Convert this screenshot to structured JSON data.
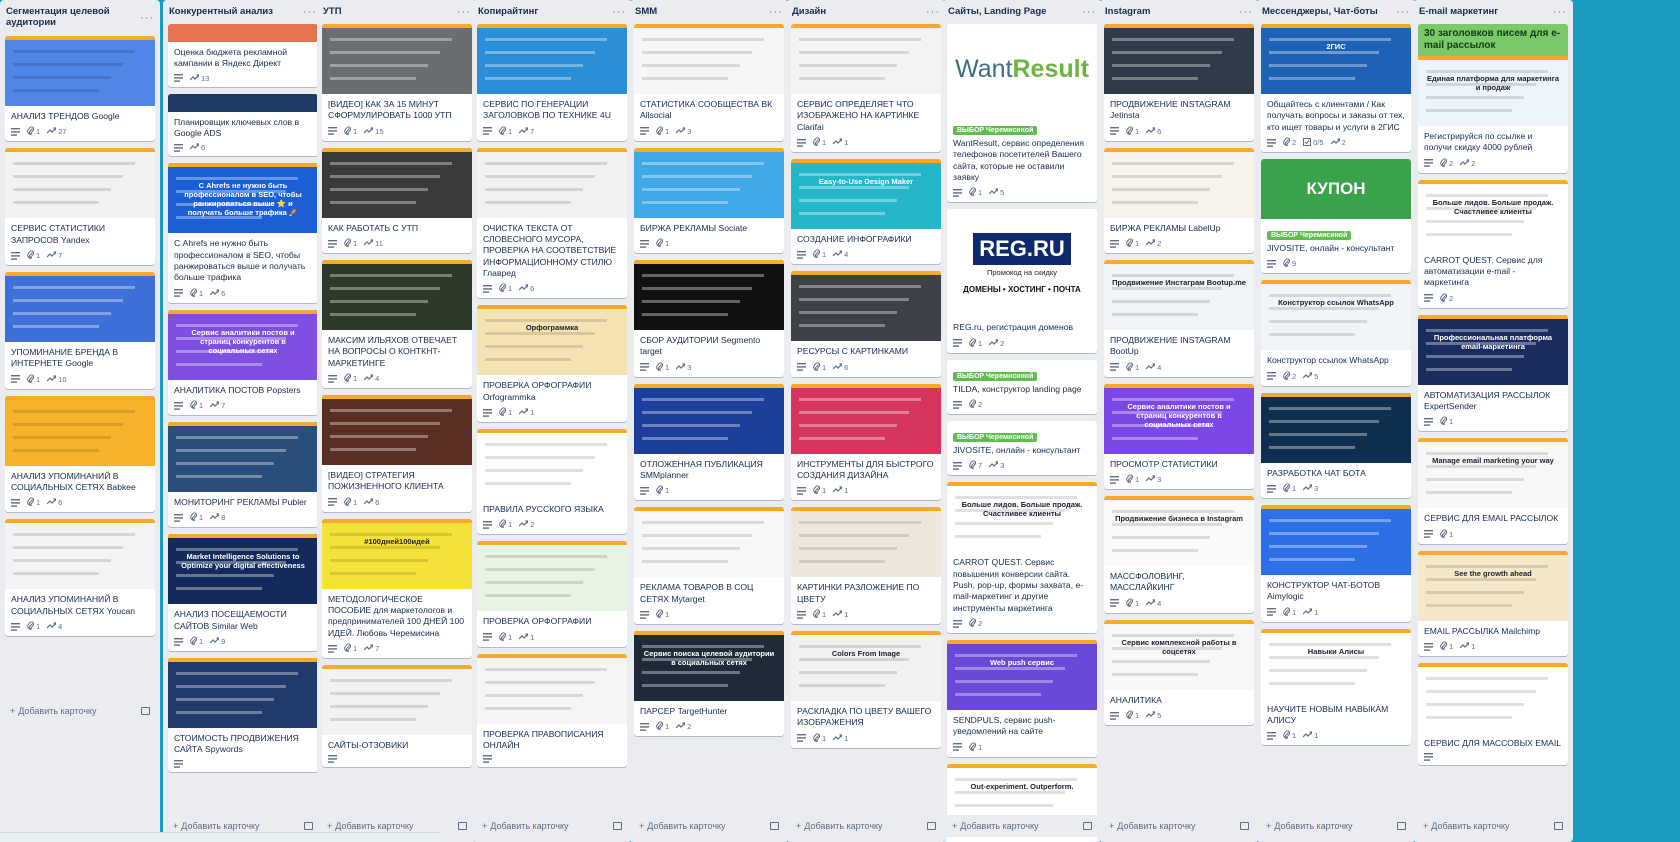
{
  "add_card_label": "Добавить карточку",
  "menu_glyph": "···",
  "icons": {
    "description": "description-icon",
    "attachment": "attachment-icon",
    "activity": "trend-icon",
    "checklist": "checklist-icon"
  },
  "colors": {
    "board": "#1a9bc2",
    "list": "#ebecf0",
    "cover_bar": "#f7a928",
    "label_green": "#61bd4f"
  },
  "columns": [
    {
      "title": "Сегментация целевой аудитории",
      "cards": [
        {
          "title": "АНАЛИЗ ТРЕНДОВ Google",
          "cover": "#4f86e8",
          "badges": [
            "1",
            "27"
          ]
        },
        {
          "title": "СЕРВИС СТАТИСТИКИ ЗАПРОСОВ Yandex",
          "cover": "#f2f2f2",
          "badges": [
            "1",
            "7"
          ]
        },
        {
          "title": "УПОМИНАНИЕ БРЕНДА В ИНТЕРНЕТЕ Google",
          "cover": "#3f6fd8",
          "badges": [
            "1",
            "10"
          ]
        },
        {
          "title": "АНАЛИЗ УПОМИНАНИЙ В СОЦИАЛЬНЫХ СЕТЯХ Babkee",
          "cover": "#f6b22a",
          "badges": [
            "1",
            "6"
          ]
        },
        {
          "title": "АНАЛИЗ УПОМИНАНИЙ В СОЦИАЛЬНЫХ СЕТЯХ Youcan",
          "cover": "#f3f3f6",
          "badges": [
            "1",
            "4"
          ]
        }
      ]
    },
    {
      "title": "Конкурентный анализ",
      "cards": [
        {
          "title": "Оценка бюджета рекламной кампании в Яндекс Директ",
          "cover": "#e57352",
          "cover_short": true,
          "badges": [
            "13"
          ]
        },
        {
          "title": "Планировщик ключевых слов в Google ADS",
          "cover": "#1c3a63",
          "cover_short": true,
          "badges": [
            "6"
          ]
        },
        {
          "title": "С Ahrefs не нужно быть профессионалом в SEO, чтобы ранжироваться выше и получать больше трафика",
          "cover": "#1a5fd6",
          "cover_text": "С Ahrefs не нужно быть профессионалом в SEO, чтобы ранжироваться выше ⭐ и получать больше трафика 🚀",
          "badges": [
            "1",
            "6"
          ]
        },
        {
          "title": "АНАЛИТИКА ПОСТОВ Popsters",
          "cover": "#7e4fe0",
          "cover_text": "Сервис аналитики постов и страниц конкурентов в социальных сетях",
          "badges": [
            "1",
            "7"
          ]
        },
        {
          "title": "МОНИТОРИНГ РЕКЛАМЫ Publer",
          "cover": "#2a4f7a",
          "badges": [
            "1",
            "8"
          ]
        },
        {
          "title": "АНАЛИЗ ПОСЕЩАЕМОСТИ САЙТОВ Similar Web",
          "cover": "#132a5a",
          "cover_text": "Market Intelligence Solutions to Optimize your digital effectiveness",
          "badges": [
            "1",
            "9"
          ]
        },
        {
          "title": "СТОИМОСТЬ ПРОДВИЖЕНИЯ САЙТА Spywords",
          "cover": "#1f3a6b",
          "badges": []
        }
      ]
    },
    {
      "title": "УТП",
      "cards": [
        {
          "title": "[ВИДЕО] КАК ЗА 15 МИНУТ СФОРМУЛИРОВАТЬ 1000 УТП",
          "cover": "#6b6e70",
          "badges": [
            "1",
            "15"
          ]
        },
        {
          "title": "КАК РАБОТАТЬ С УТП",
          "cover": "#3a3a3a",
          "badges": [
            "1",
            "11"
          ]
        },
        {
          "title": "МАКСИМ ИЛЬЯХОВ ОТВЕЧАЕТ НА ВОПРОСЫ О КОНТКНТ-МАРКЕТИНГЕ",
          "cover": "#2d3a2a",
          "badges": [
            "1",
            "4"
          ]
        },
        {
          "title": "[ВИДЕО] СТРАТЕГИЯ ПОЖИЗНЕННОГО КЛИЕНТА",
          "cover": "#5a2e22",
          "badges": [
            "1",
            "6"
          ]
        },
        {
          "title": "МЕТОДОЛОГИЧЕСКОЕ ПОСОБИЕ для маркетологов и предпринимателей 100 ДНЕЙ 100 ИДЕЙ. Любовь Черемисина",
          "cover": "#f4e23a",
          "cover_text": "#100дней100идей",
          "badges": [
            "1",
            "7"
          ]
        },
        {
          "title": "САЙТЫ-ОТЗОВИКИ",
          "cover": "#f2f2f2",
          "badges": []
        }
      ]
    },
    {
      "title": "Копирайтинг",
      "cards": [
        {
          "title": "СЕРВИС ПО ГЕНЕРАЦИИ ЗАГОЛОВКОВ ПО ТЕХНИКЕ 4U",
          "cover": "#2a8fd6",
          "badges": [
            "1",
            "7"
          ]
        },
        {
          "title": "ОЧИСТКА ТЕКСТА ОТ СЛОВЕСНОГО МУСОРА, ПРОВЕРКА НА СООТВЕТСТВИЕ ИНФОРМАЦИОННОМУ СТИЛЮ Главред",
          "cover": "#f1f1f1",
          "badges": [
            "1",
            "6"
          ]
        },
        {
          "title": "ПРОВЕРКА ОРФОГРАФИИ Orfogrammka",
          "cover": "#f6e3b4",
          "cover_text": "Орфограммка",
          "badges": [
            "1",
            "1"
          ]
        },
        {
          "title": "ПРАВИЛА РУССКОГО ЯЗЫКА",
          "cover": "#ffffff",
          "badges": [
            "1",
            "2"
          ]
        },
        {
          "title": "ПРОВЕРКА ОРФОГРАФИИ",
          "cover": "#e9f3e2",
          "badges": [
            "1",
            "1"
          ]
        },
        {
          "title": "ПРОВЕРКА ПРАВОПИСАНИЯ ОНЛАЙН",
          "cover": "#f5f5f5",
          "badges": []
        }
      ]
    },
    {
      "title": "SMM",
      "cards": [
        {
          "title": "СТАТИСТИКА СООБЩЕСТВА ВК Allsocial",
          "cover": "#f4f6f8",
          "badges": [
            "1",
            "3"
          ]
        },
        {
          "title": "БИРЖА РЕКЛАМЫ Sociate",
          "cover": "#41a8e8",
          "badges": [
            "1"
          ]
        },
        {
          "title": "СБОР АУДИТОРИИ Segmento target",
          "cover": "#111111",
          "badges": [
            "1",
            "3"
          ]
        },
        {
          "title": "ОТЛОЖЕННАЯ ПУБЛИКАЦИЯ SMMplanner",
          "cover": "#1d3f9c",
          "badges": [
            "1"
          ]
        },
        {
          "title": "РЕКЛАМА ТОВАРОВ В СОЦ СЕТЯХ Mytarget",
          "cover": "#f7f7f7",
          "badges": [
            "1"
          ]
        },
        {
          "title": "ПАРСЕР TargetHunter",
          "cover": "#1e2a38",
          "cover_text": "Сервис поиска целевой аудитории в социальных сетях",
          "badges": [
            "1",
            "2"
          ]
        }
      ]
    },
    {
      "title": "Дизайн",
      "cards": [
        {
          "title": "СЕРВИС ОПРЕДЕЛЯЕТ ЧТО ИЗОБРАЖЕНО НА КАРТИНКЕ Clarifai",
          "cover": "#f3f3f3",
          "badges": [
            "1",
            "1"
          ]
        },
        {
          "title": "СОЗДАНИЕ ИНФОГРАФИКИ",
          "cover": "#25b7c9",
          "cover_text": "Easy-to-Use Design Maker",
          "badges": [
            "1",
            "4"
          ]
        },
        {
          "title": "РЕСУРСЫ С КАРТИНКАМИ",
          "cover": "#3d4147",
          "badges": [
            "1",
            "6"
          ]
        },
        {
          "title": "ИНСТРУМЕНТЫ ДЛЯ БЫСТРОГО СОЗДАНИЯ ДИЗАЙНА",
          "cover": "#d6355d",
          "badges": [
            "1",
            "1"
          ]
        },
        {
          "title": "КАРТИНКИ РАЗЛОЖЕНИЕ ПО ЦВЕТУ",
          "cover": "#efe7dc",
          "badges": [
            "1",
            "1"
          ]
        },
        {
          "title": "РАСКЛАДКА ПО ЦВЕТУ ВАШЕГО ИЗОБРАЖЕНИЯ",
          "cover": "#f1f1f1",
          "cover_text": "Colors From Image",
          "badges": [
            "1",
            "1"
          ]
        }
      ]
    },
    {
      "title": "Сайты, Landing Page",
      "cards": [
        {
          "title": "WantResult, сервис определения телефонов посетителей Вашего сайта, которые не оставили заявку",
          "special": "wantresult",
          "label": "ВЫБОР Черемисиной",
          "badges": [
            "1",
            "5"
          ]
        },
        {
          "title": "REG.ru, регистрация доменов",
          "special": "reg",
          "reg_sub": "Промокод на скидку",
          "reg_line": "ДОМЕНЫ • ХОСТИНГ • ПОЧТА",
          "badges": [
            "1",
            "2"
          ]
        },
        {
          "title": "TILDA, конструктор landing page",
          "label": "ВЫБОР Черемисиной",
          "badges": [
            "2"
          ]
        },
        {
          "title": "JIVOSITE, онлайн - консультант",
          "label": "ВЫБОР Черемисиной",
          "badges": [
            "7",
            "3"
          ]
        },
        {
          "title": "CARROT QUEST. Сервис повышения конверсии сайта. Push, pop-up, формы захвата, e-mail-маркетинг и другие инструменты маркетинга",
          "cover": "#ffffff",
          "cover_text": "Больше лидов. Больше продаж. Счастливее клиенты",
          "badges": [
            "2"
          ]
        },
        {
          "title": "SENDPULS, сервис push-уведомлений на сайте",
          "cover": "#6a49d8",
          "cover_text": "Web push сервис",
          "badges": [
            "1"
          ]
        },
        {
          "title": "",
          "cover": "#ffffff",
          "cover_text": "Out-experiment. Outperform.",
          "badges": []
        }
      ]
    },
    {
      "title": "Instagram",
      "cards": [
        {
          "title": "ПРОДВИЖЕНИЕ INSTAGRAM Jetinsta",
          "cover": "#2f3b48",
          "badges": [
            "1",
            "6"
          ]
        },
        {
          "title": "БИРЖА РЕКЛАМЫ LabelUp",
          "cover": "#f7f2ec",
          "badges": [
            "1",
            "2"
          ]
        },
        {
          "title": "ПРОДВИЖЕНИЕ INSTAGRAM BootUp",
          "cover": "#f0f4f7",
          "cover_text": "Продвижение Инстаграм Bootup.me",
          "badges": [
            "1",
            "4"
          ]
        },
        {
          "title": "ПРОСМОТР СТАТИСТИКИ",
          "cover": "#7b47e6",
          "cover_text": "Сервис аналитики постов и страниц конкурентов в социальных сетях",
          "badges": [
            "1",
            "3"
          ]
        },
        {
          "title": "МАССФОЛОВИНГ, МАССЛАЙКИНГ",
          "cover": "#fafafa",
          "cover_text": "Продвижение бизнеса в Instagram",
          "badges": [
            "1",
            "4"
          ]
        },
        {
          "title": "АНАЛИТИКА",
          "cover": "#f7f7f7",
          "cover_text": "Сервис комплексной работы в соцсетях",
          "badges": [
            "1",
            "5"
          ]
        }
      ]
    },
    {
      "title": "Мессенджеры, Чат-боты",
      "cards": [
        {
          "title": "Общайтесь с клиентами / Как получать вопросы и заказы от тех, кто ищет товары и услуги в 2ГИС",
          "cover": "#1e62b8",
          "cover_text": "2ГИС",
          "badges": [
            "2",
            "0/5",
            "2"
          ]
        },
        {
          "title": "JIVOSITE, онлайн - консультант",
          "special": "kupon",
          "kupon": "КУПОН",
          "label": "ВЫБОР Черемисиной",
          "badges": [
            "9"
          ]
        },
        {
          "title": "Конструктор ссылок WhatsApp",
          "cover": "#f2f5f8",
          "cover_text": "Конструктор ссылок WhatsApp",
          "badges": [
            "2",
            "5"
          ]
        },
        {
          "title": "РАЗРАБОТКА ЧАТ БОТА",
          "cover": "#0e2f4f",
          "badges": [
            "1",
            "3"
          ]
        },
        {
          "title": "КОНСТРУКТОР ЧАТ-БОТОВ Aimylogic",
          "cover": "#2c6fe6",
          "badges": [
            "1",
            "1"
          ]
        },
        {
          "title": "НАУЧИТЕ НОВЫМ НАВЫКАМ АЛИСУ",
          "cover": "#ffffff",
          "cover_text": "Навыки Алисы",
          "badges": [
            "1",
            "1"
          ]
        }
      ]
    },
    {
      "title": "E-mail маркетинг",
      "cards": [
        {
          "title": "Регистрируйся по ссылке и получи скидку 4000 рублей",
          "special": "green",
          "green_head": "30 заголовков писем для e-mail рассылок",
          "cover": "#eef4fb",
          "cover_text": "Единая платформа для маркетинга и продаж",
          "badges": [
            "2",
            "2"
          ]
        },
        {
          "title": "CARROT QUEST. Сервис для автоматизации e-mail - маркетинга",
          "cover": "#ffffff",
          "cover_text": "Больше лидов. Больше продаж. Счастливее клиенты",
          "badges": [
            "2"
          ]
        },
        {
          "title": "АВТОМАТИЗАЦИЯ РАССЫЛОК ExpertSender",
          "cover": "#1a2c5e",
          "cover_text": "Профессиональная платформа email-маркетинга",
          "badges": [
            "1"
          ]
        },
        {
          "title": "СЕРВИС ДЛЯ EMAIL РАССЫЛОК",
          "cover": "#f7f7f7",
          "cover_text": "Manage email marketing your way",
          "badges": [
            "1"
          ]
        },
        {
          "title": "EMAIL РАССЫЛКА Mailchimp",
          "cover": "#f4e8c9",
          "cover_text": "See the growth ahead",
          "badges": [
            "1",
            "1"
          ]
        },
        {
          "title": "СЕРВИС ДЛЯ МАССОВЫХ EMAIL",
          "cover": "#ffffff",
          "badges": []
        }
      ]
    }
  ]
}
